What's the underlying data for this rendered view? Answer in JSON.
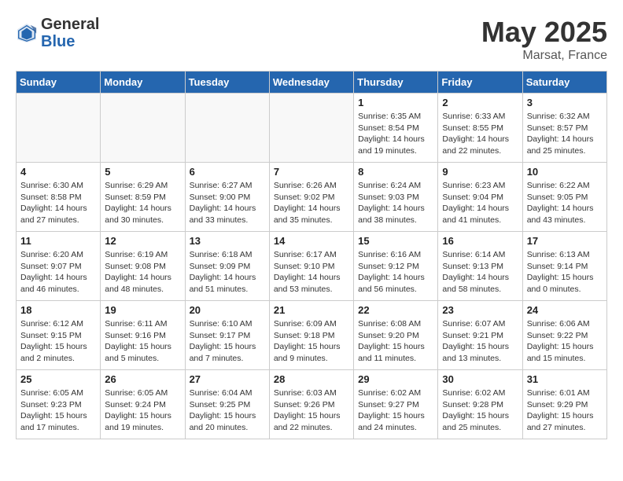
{
  "header": {
    "logo_general": "General",
    "logo_blue": "Blue",
    "title": "May 2025",
    "subtitle": "Marsat, France"
  },
  "days_of_week": [
    "Sunday",
    "Monday",
    "Tuesday",
    "Wednesday",
    "Thursday",
    "Friday",
    "Saturday"
  ],
  "weeks": [
    [
      {
        "day": "",
        "detail": ""
      },
      {
        "day": "",
        "detail": ""
      },
      {
        "day": "",
        "detail": ""
      },
      {
        "day": "",
        "detail": ""
      },
      {
        "day": "1",
        "detail": "Sunrise: 6:35 AM\nSunset: 8:54 PM\nDaylight: 14 hours\nand 19 minutes."
      },
      {
        "day": "2",
        "detail": "Sunrise: 6:33 AM\nSunset: 8:55 PM\nDaylight: 14 hours\nand 22 minutes."
      },
      {
        "day": "3",
        "detail": "Sunrise: 6:32 AM\nSunset: 8:57 PM\nDaylight: 14 hours\nand 25 minutes."
      }
    ],
    [
      {
        "day": "4",
        "detail": "Sunrise: 6:30 AM\nSunset: 8:58 PM\nDaylight: 14 hours\nand 27 minutes."
      },
      {
        "day": "5",
        "detail": "Sunrise: 6:29 AM\nSunset: 8:59 PM\nDaylight: 14 hours\nand 30 minutes."
      },
      {
        "day": "6",
        "detail": "Sunrise: 6:27 AM\nSunset: 9:00 PM\nDaylight: 14 hours\nand 33 minutes."
      },
      {
        "day": "7",
        "detail": "Sunrise: 6:26 AM\nSunset: 9:02 PM\nDaylight: 14 hours\nand 35 minutes."
      },
      {
        "day": "8",
        "detail": "Sunrise: 6:24 AM\nSunset: 9:03 PM\nDaylight: 14 hours\nand 38 minutes."
      },
      {
        "day": "9",
        "detail": "Sunrise: 6:23 AM\nSunset: 9:04 PM\nDaylight: 14 hours\nand 41 minutes."
      },
      {
        "day": "10",
        "detail": "Sunrise: 6:22 AM\nSunset: 9:05 PM\nDaylight: 14 hours\nand 43 minutes."
      }
    ],
    [
      {
        "day": "11",
        "detail": "Sunrise: 6:20 AM\nSunset: 9:07 PM\nDaylight: 14 hours\nand 46 minutes."
      },
      {
        "day": "12",
        "detail": "Sunrise: 6:19 AM\nSunset: 9:08 PM\nDaylight: 14 hours\nand 48 minutes."
      },
      {
        "day": "13",
        "detail": "Sunrise: 6:18 AM\nSunset: 9:09 PM\nDaylight: 14 hours\nand 51 minutes."
      },
      {
        "day": "14",
        "detail": "Sunrise: 6:17 AM\nSunset: 9:10 PM\nDaylight: 14 hours\nand 53 minutes."
      },
      {
        "day": "15",
        "detail": "Sunrise: 6:16 AM\nSunset: 9:12 PM\nDaylight: 14 hours\nand 56 minutes."
      },
      {
        "day": "16",
        "detail": "Sunrise: 6:14 AM\nSunset: 9:13 PM\nDaylight: 14 hours\nand 58 minutes."
      },
      {
        "day": "17",
        "detail": "Sunrise: 6:13 AM\nSunset: 9:14 PM\nDaylight: 15 hours\nand 0 minutes."
      }
    ],
    [
      {
        "day": "18",
        "detail": "Sunrise: 6:12 AM\nSunset: 9:15 PM\nDaylight: 15 hours\nand 2 minutes."
      },
      {
        "day": "19",
        "detail": "Sunrise: 6:11 AM\nSunset: 9:16 PM\nDaylight: 15 hours\nand 5 minutes."
      },
      {
        "day": "20",
        "detail": "Sunrise: 6:10 AM\nSunset: 9:17 PM\nDaylight: 15 hours\nand 7 minutes."
      },
      {
        "day": "21",
        "detail": "Sunrise: 6:09 AM\nSunset: 9:18 PM\nDaylight: 15 hours\nand 9 minutes."
      },
      {
        "day": "22",
        "detail": "Sunrise: 6:08 AM\nSunset: 9:20 PM\nDaylight: 15 hours\nand 11 minutes."
      },
      {
        "day": "23",
        "detail": "Sunrise: 6:07 AM\nSunset: 9:21 PM\nDaylight: 15 hours\nand 13 minutes."
      },
      {
        "day": "24",
        "detail": "Sunrise: 6:06 AM\nSunset: 9:22 PM\nDaylight: 15 hours\nand 15 minutes."
      }
    ],
    [
      {
        "day": "25",
        "detail": "Sunrise: 6:05 AM\nSunset: 9:23 PM\nDaylight: 15 hours\nand 17 minutes."
      },
      {
        "day": "26",
        "detail": "Sunrise: 6:05 AM\nSunset: 9:24 PM\nDaylight: 15 hours\nand 19 minutes."
      },
      {
        "day": "27",
        "detail": "Sunrise: 6:04 AM\nSunset: 9:25 PM\nDaylight: 15 hours\nand 20 minutes."
      },
      {
        "day": "28",
        "detail": "Sunrise: 6:03 AM\nSunset: 9:26 PM\nDaylight: 15 hours\nand 22 minutes."
      },
      {
        "day": "29",
        "detail": "Sunrise: 6:02 AM\nSunset: 9:27 PM\nDaylight: 15 hours\nand 24 minutes."
      },
      {
        "day": "30",
        "detail": "Sunrise: 6:02 AM\nSunset: 9:28 PM\nDaylight: 15 hours\nand 25 minutes."
      },
      {
        "day": "31",
        "detail": "Sunrise: 6:01 AM\nSunset: 9:29 PM\nDaylight: 15 hours\nand 27 minutes."
      }
    ]
  ]
}
